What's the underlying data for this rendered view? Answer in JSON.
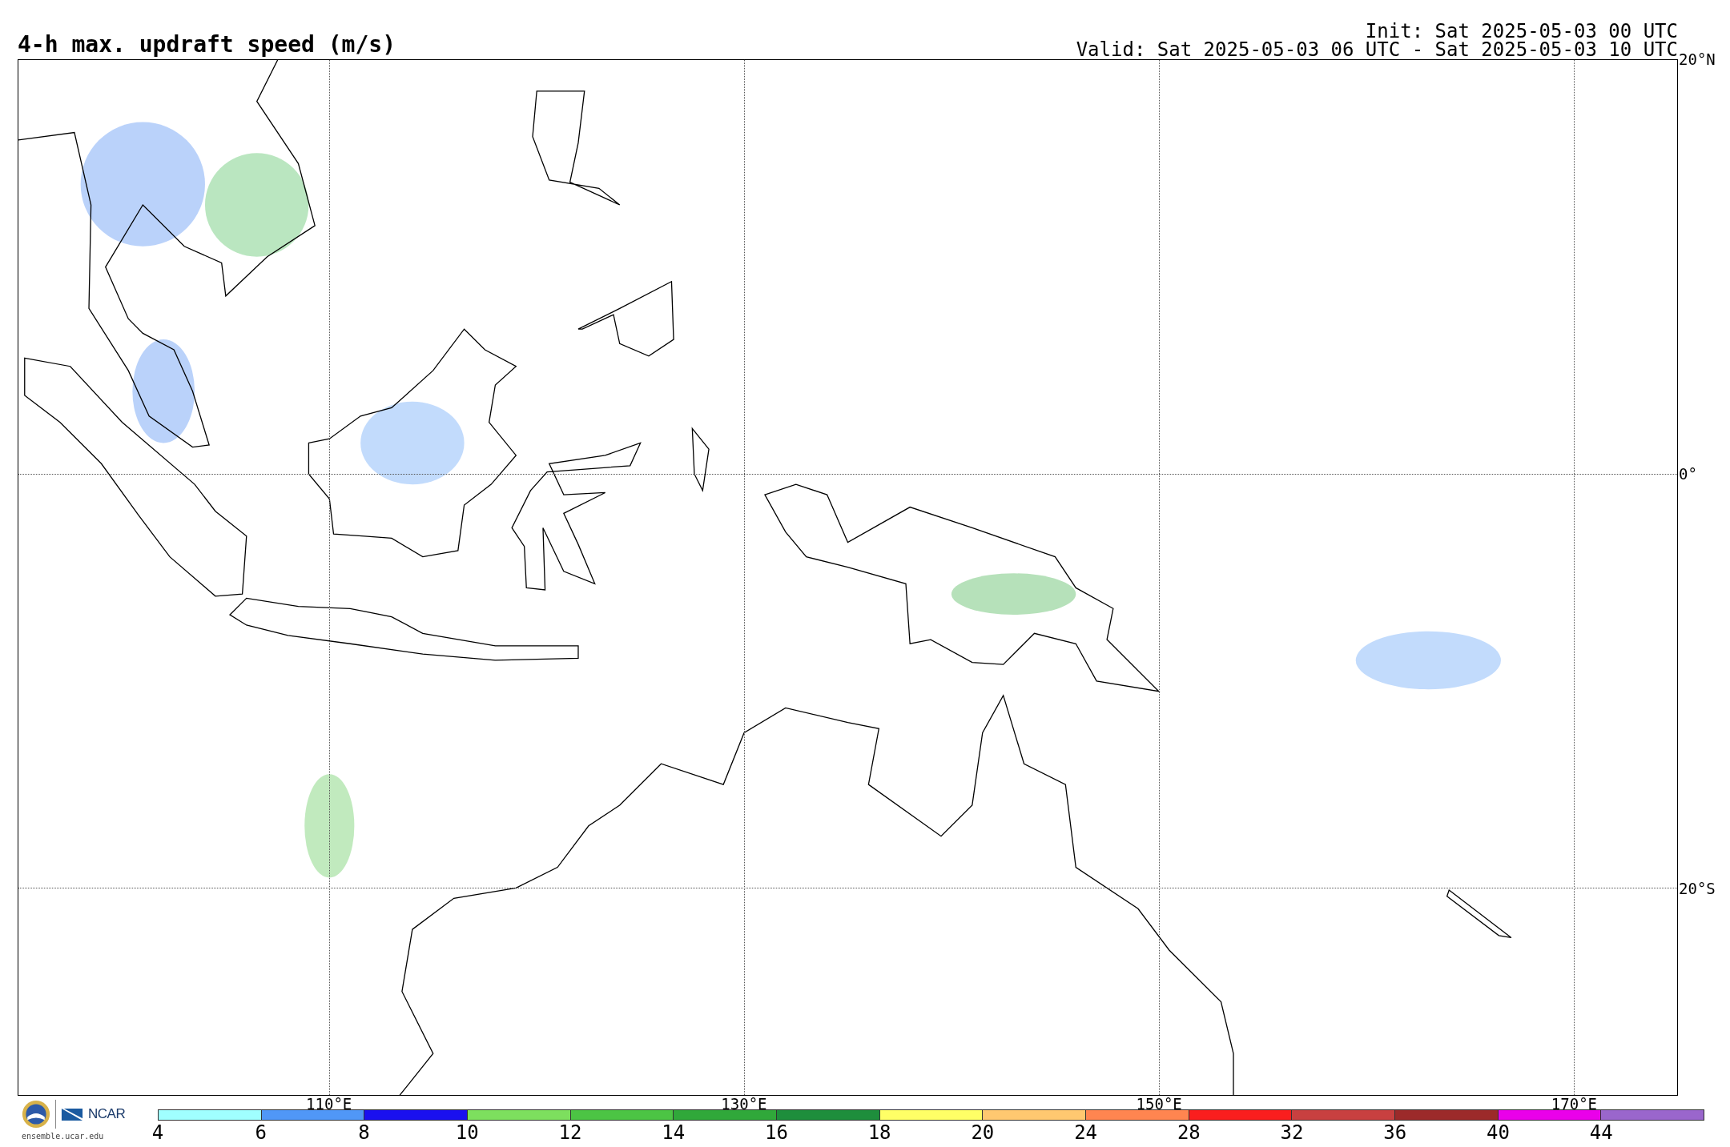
{
  "title": "4-h max. updraft speed (m/s)",
  "init": "Init: Sat 2025-05-03 00 UTC",
  "valid": "Valid: Sat 2025-05-03 06 UTC - Sat 2025-05-03 10 UTC",
  "map": {
    "lat_labels": [
      "20°N",
      "0°",
      "20°S"
    ],
    "lon_labels": [
      "110°E",
      "130°E",
      "150°E",
      "170°E"
    ]
  },
  "logo": {
    "name": "NCAR",
    "url": "ensemble.ucar.edu"
  },
  "colorbar": {
    "ticks": [
      "4",
      "6",
      "8",
      "10",
      "12",
      "14",
      "16",
      "18",
      "20",
      "24",
      "28",
      "32",
      "36",
      "40",
      "44"
    ],
    "segments": [
      {
        "color": "#a0ffff"
      },
      {
        "color": "#5097f7"
      },
      {
        "color": "#1a10ef"
      },
      {
        "color": "#7ddf5e"
      },
      {
        "color": "#4cc444"
      },
      {
        "color": "#30a83a"
      },
      {
        "color": "#1e8e3c"
      },
      {
        "color": "#ffff66"
      },
      {
        "color": "#ffc870"
      },
      {
        "color": "#ff8550"
      },
      {
        "color": "#fa1e1e"
      },
      {
        "color": "#c84040"
      },
      {
        "color": "#9c2a2a"
      },
      {
        "color": "#ea00ea"
      },
      {
        "color": "#9a66cc"
      }
    ]
  }
}
